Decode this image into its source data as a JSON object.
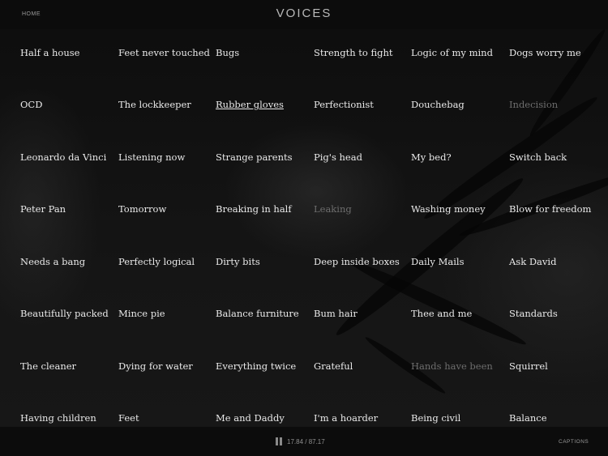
{
  "header": {
    "home_label": "HOME",
    "title": "VOICES"
  },
  "grid": {
    "rows": [
      [
        {
          "label": "Half a house",
          "state": "normal"
        },
        {
          "label": "Feet never touched",
          "state": "normal"
        },
        {
          "label": "Bugs",
          "state": "normal"
        },
        {
          "label": "Strength to fight",
          "state": "normal"
        },
        {
          "label": "Logic of my mind",
          "state": "normal"
        },
        {
          "label": "Dogs worry me",
          "state": "normal"
        }
      ],
      [
        {
          "label": "OCD",
          "state": "normal"
        },
        {
          "label": "The lockkeeper",
          "state": "normal"
        },
        {
          "label": "Rubber gloves",
          "state": "active"
        },
        {
          "label": "Perfectionist",
          "state": "normal"
        },
        {
          "label": "Douchebag",
          "state": "normal"
        },
        {
          "label": "Indecision",
          "state": "dim"
        }
      ],
      [
        {
          "label": "Leonardo da Vinci",
          "state": "normal"
        },
        {
          "label": "Listening now",
          "state": "normal"
        },
        {
          "label": "Strange parents",
          "state": "normal"
        },
        {
          "label": "Pig's head",
          "state": "normal"
        },
        {
          "label": "My bed?",
          "state": "normal"
        },
        {
          "label": "Switch back",
          "state": "normal"
        }
      ],
      [
        {
          "label": "Peter Pan",
          "state": "normal"
        },
        {
          "label": "Tomorrow",
          "state": "normal"
        },
        {
          "label": "Breaking in half",
          "state": "normal"
        },
        {
          "label": "Leaking",
          "state": "dim"
        },
        {
          "label": "Washing money",
          "state": "normal"
        },
        {
          "label": "Blow for freedom",
          "state": "normal"
        }
      ],
      [
        {
          "label": "Needs a bang",
          "state": "normal"
        },
        {
          "label": "Perfectly logical",
          "state": "normal"
        },
        {
          "label": "Dirty bits",
          "state": "normal"
        },
        {
          "label": "Deep inside boxes",
          "state": "normal"
        },
        {
          "label": "Daily Mails",
          "state": "normal"
        },
        {
          "label": "Ask David",
          "state": "normal"
        }
      ],
      [
        {
          "label": "Beautifully packed",
          "state": "normal"
        },
        {
          "label": "Mince pie",
          "state": "normal"
        },
        {
          "label": "Balance furniture",
          "state": "normal"
        },
        {
          "label": "Bum hair",
          "state": "normal"
        },
        {
          "label": "Thee and me",
          "state": "normal"
        },
        {
          "label": "Standards",
          "state": "normal"
        }
      ],
      [
        {
          "label": "The cleaner",
          "state": "normal"
        },
        {
          "label": "Dying for water",
          "state": "normal"
        },
        {
          "label": "Everything twice",
          "state": "normal"
        },
        {
          "label": "Grateful",
          "state": "normal"
        },
        {
          "label": "Hands have been",
          "state": "dim"
        },
        {
          "label": "Squirrel",
          "state": "normal"
        }
      ],
      [
        {
          "label": "Having children",
          "state": "normal"
        },
        {
          "label": "Feet",
          "state": "normal"
        },
        {
          "label": "Me and Daddy",
          "state": "normal"
        },
        {
          "label": "I'm a hoarder",
          "state": "normal"
        },
        {
          "label": "Being civil",
          "state": "normal"
        },
        {
          "label": "Balance",
          "state": "normal"
        }
      ]
    ]
  },
  "footer": {
    "play_state_icon": "pause-icon",
    "time": "17.84 / 87.17",
    "current_time": 17.84,
    "duration": 87.17,
    "captions_label": "CAPTIONS"
  },
  "colors": {
    "background": "#0d0d0d",
    "text": "#e9e9e9",
    "dim_text": "#6d6d6d",
    "chrome_text": "#9a9a9a"
  }
}
